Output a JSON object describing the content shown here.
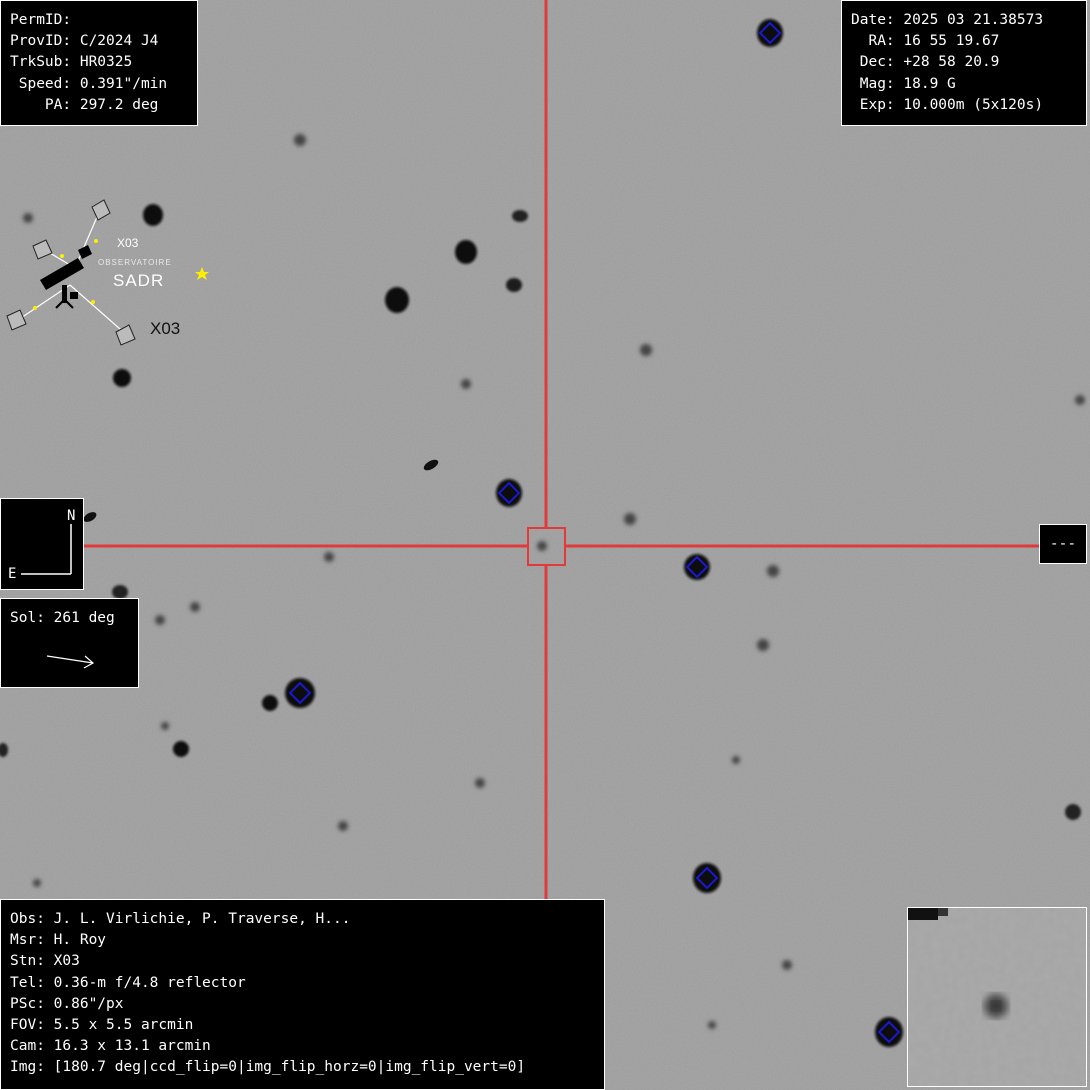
{
  "header_left": {
    "perm_id": "PermID:",
    "prov_id": "ProvID: C/2024 J4",
    "trk_sub": "TrkSub: HR0325",
    "speed": " Speed: 0.391\"/min",
    "pa": "    PA: 297.2 deg"
  },
  "header_right": {
    "date": "Date: 2025 03 21.38573",
    "ra": "  RA: 16 55 19.67",
    "dec": " Dec: +28 58 20.9",
    "mag": " Mag: 18.9 G",
    "exp": " Exp: 10.000m (5x120s)"
  },
  "observatory_logo": {
    "code_small": "X03",
    "subtitle": "OBSERVATOIRE",
    "name": "SADR",
    "code_large": "X03",
    "accent": "#ffee00"
  },
  "compass": {
    "north": "N",
    "east": "E"
  },
  "sol": {
    "label": "Sol: 261 deg"
  },
  "offscale": {
    "label": "---"
  },
  "footer": {
    "obs": "Obs: J. L. Virlichie, P. Traverse, H...",
    "msr": "Msr: H. Roy",
    "stn": "Stn: X03",
    "tel": "Tel: 0.36-m f/4.8 reflector",
    "psc": "PSc: 0.86\"/px",
    "fov": "FOV: 5.5 x 5.5 arcmin",
    "cam": "Cam: 16.3 x 13.1 arcmin",
    "img": "Img: [180.7 deg|ccd_flip=0|img_flip_horz=0|img_flip_vert=0]"
  },
  "colors": {
    "sky": "#9a9a9a",
    "crosshair": "#e23a3a",
    "reference_marker": "#1a1acc",
    "panel_bg": "#000000",
    "panel_text": "#ffffff"
  }
}
